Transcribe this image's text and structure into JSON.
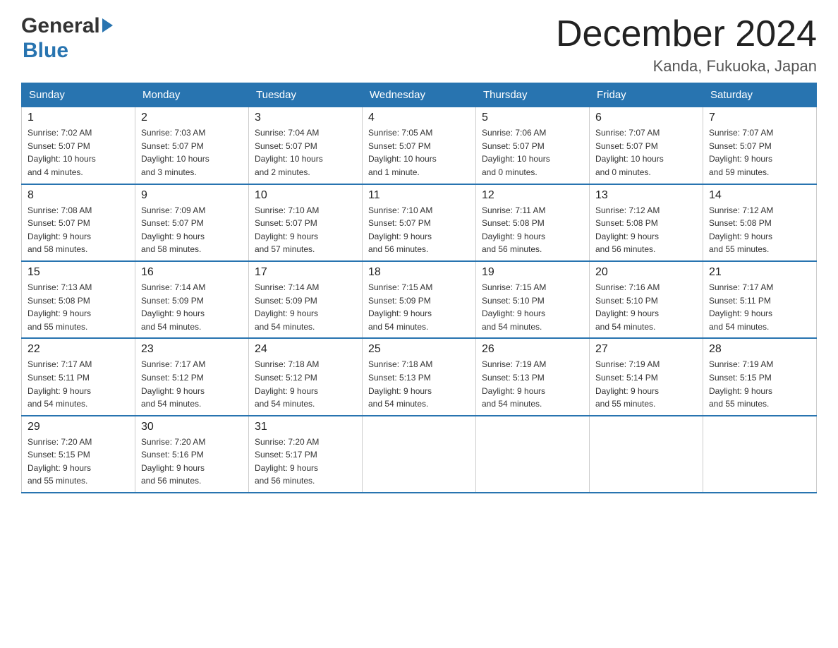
{
  "header": {
    "title": "December 2024",
    "subtitle": "Kanda, Fukuoka, Japan",
    "logo_general": "General",
    "logo_blue": "Blue"
  },
  "days_of_week": [
    "Sunday",
    "Monday",
    "Tuesday",
    "Wednesday",
    "Thursday",
    "Friday",
    "Saturday"
  ],
  "weeks": [
    [
      {
        "day": "1",
        "info": "Sunrise: 7:02 AM\nSunset: 5:07 PM\nDaylight: 10 hours\nand 4 minutes."
      },
      {
        "day": "2",
        "info": "Sunrise: 7:03 AM\nSunset: 5:07 PM\nDaylight: 10 hours\nand 3 minutes."
      },
      {
        "day": "3",
        "info": "Sunrise: 7:04 AM\nSunset: 5:07 PM\nDaylight: 10 hours\nand 2 minutes."
      },
      {
        "day": "4",
        "info": "Sunrise: 7:05 AM\nSunset: 5:07 PM\nDaylight: 10 hours\nand 1 minute."
      },
      {
        "day": "5",
        "info": "Sunrise: 7:06 AM\nSunset: 5:07 PM\nDaylight: 10 hours\nand 0 minutes."
      },
      {
        "day": "6",
        "info": "Sunrise: 7:07 AM\nSunset: 5:07 PM\nDaylight: 10 hours\nand 0 minutes."
      },
      {
        "day": "7",
        "info": "Sunrise: 7:07 AM\nSunset: 5:07 PM\nDaylight: 9 hours\nand 59 minutes."
      }
    ],
    [
      {
        "day": "8",
        "info": "Sunrise: 7:08 AM\nSunset: 5:07 PM\nDaylight: 9 hours\nand 58 minutes."
      },
      {
        "day": "9",
        "info": "Sunrise: 7:09 AM\nSunset: 5:07 PM\nDaylight: 9 hours\nand 58 minutes."
      },
      {
        "day": "10",
        "info": "Sunrise: 7:10 AM\nSunset: 5:07 PM\nDaylight: 9 hours\nand 57 minutes."
      },
      {
        "day": "11",
        "info": "Sunrise: 7:10 AM\nSunset: 5:07 PM\nDaylight: 9 hours\nand 56 minutes."
      },
      {
        "day": "12",
        "info": "Sunrise: 7:11 AM\nSunset: 5:08 PM\nDaylight: 9 hours\nand 56 minutes."
      },
      {
        "day": "13",
        "info": "Sunrise: 7:12 AM\nSunset: 5:08 PM\nDaylight: 9 hours\nand 56 minutes."
      },
      {
        "day": "14",
        "info": "Sunrise: 7:12 AM\nSunset: 5:08 PM\nDaylight: 9 hours\nand 55 minutes."
      }
    ],
    [
      {
        "day": "15",
        "info": "Sunrise: 7:13 AM\nSunset: 5:08 PM\nDaylight: 9 hours\nand 55 minutes."
      },
      {
        "day": "16",
        "info": "Sunrise: 7:14 AM\nSunset: 5:09 PM\nDaylight: 9 hours\nand 54 minutes."
      },
      {
        "day": "17",
        "info": "Sunrise: 7:14 AM\nSunset: 5:09 PM\nDaylight: 9 hours\nand 54 minutes."
      },
      {
        "day": "18",
        "info": "Sunrise: 7:15 AM\nSunset: 5:09 PM\nDaylight: 9 hours\nand 54 minutes."
      },
      {
        "day": "19",
        "info": "Sunrise: 7:15 AM\nSunset: 5:10 PM\nDaylight: 9 hours\nand 54 minutes."
      },
      {
        "day": "20",
        "info": "Sunrise: 7:16 AM\nSunset: 5:10 PM\nDaylight: 9 hours\nand 54 minutes."
      },
      {
        "day": "21",
        "info": "Sunrise: 7:17 AM\nSunset: 5:11 PM\nDaylight: 9 hours\nand 54 minutes."
      }
    ],
    [
      {
        "day": "22",
        "info": "Sunrise: 7:17 AM\nSunset: 5:11 PM\nDaylight: 9 hours\nand 54 minutes."
      },
      {
        "day": "23",
        "info": "Sunrise: 7:17 AM\nSunset: 5:12 PM\nDaylight: 9 hours\nand 54 minutes."
      },
      {
        "day": "24",
        "info": "Sunrise: 7:18 AM\nSunset: 5:12 PM\nDaylight: 9 hours\nand 54 minutes."
      },
      {
        "day": "25",
        "info": "Sunrise: 7:18 AM\nSunset: 5:13 PM\nDaylight: 9 hours\nand 54 minutes."
      },
      {
        "day": "26",
        "info": "Sunrise: 7:19 AM\nSunset: 5:13 PM\nDaylight: 9 hours\nand 54 minutes."
      },
      {
        "day": "27",
        "info": "Sunrise: 7:19 AM\nSunset: 5:14 PM\nDaylight: 9 hours\nand 55 minutes."
      },
      {
        "day": "28",
        "info": "Sunrise: 7:19 AM\nSunset: 5:15 PM\nDaylight: 9 hours\nand 55 minutes."
      }
    ],
    [
      {
        "day": "29",
        "info": "Sunrise: 7:20 AM\nSunset: 5:15 PM\nDaylight: 9 hours\nand 55 minutes."
      },
      {
        "day": "30",
        "info": "Sunrise: 7:20 AM\nSunset: 5:16 PM\nDaylight: 9 hours\nand 56 minutes."
      },
      {
        "day": "31",
        "info": "Sunrise: 7:20 AM\nSunset: 5:17 PM\nDaylight: 9 hours\nand 56 minutes."
      },
      {
        "day": "",
        "info": ""
      },
      {
        "day": "",
        "info": ""
      },
      {
        "day": "",
        "info": ""
      },
      {
        "day": "",
        "info": ""
      }
    ]
  ]
}
